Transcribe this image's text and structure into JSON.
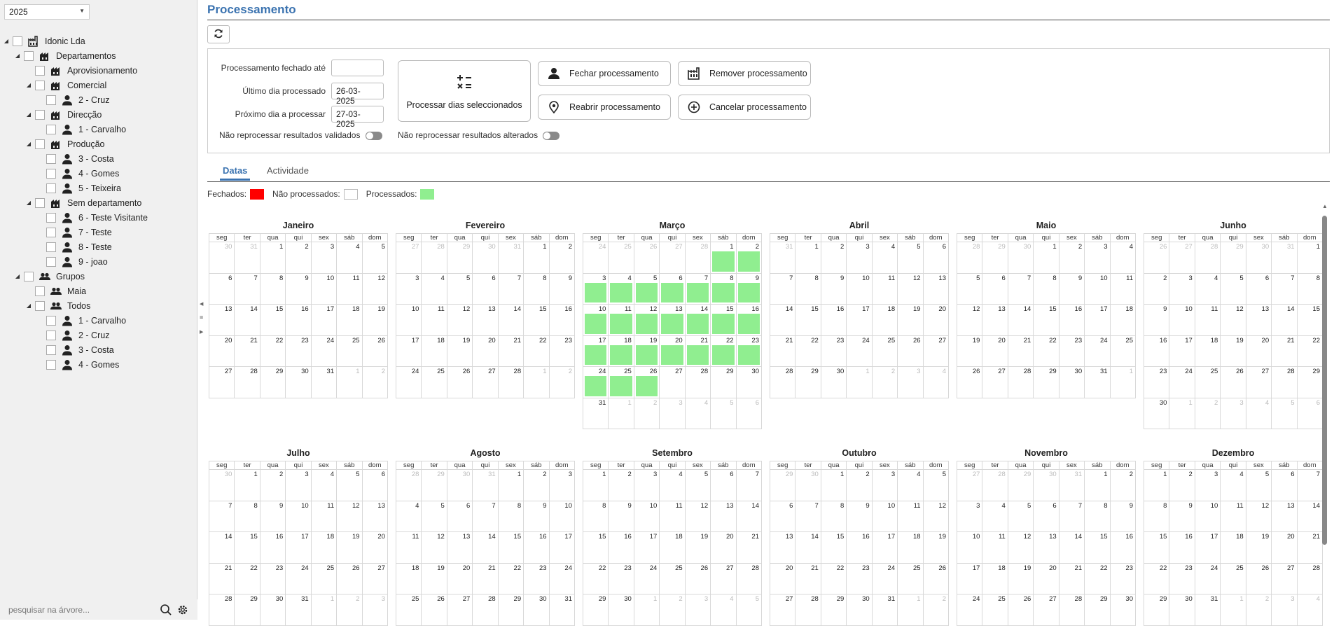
{
  "sidebar": {
    "year": "2025",
    "search_placeholder": "pesquisar na árvore...",
    "tree": [
      {
        "label": "Idonic Lda",
        "level": 0,
        "icon": "company-icon",
        "expanded": true
      },
      {
        "label": "Departamentos",
        "level": 1,
        "icon": "factory-icon",
        "expanded": true
      },
      {
        "label": "Aprovisionamento",
        "level": 2,
        "icon": "factory-icon",
        "expanded": false,
        "leaf": true
      },
      {
        "label": "Comercial",
        "level": 2,
        "icon": "factory-icon",
        "expanded": true
      },
      {
        "label": "2 - Cruz",
        "level": 3,
        "icon": "person-icon",
        "leaf": true
      },
      {
        "label": "Direcção",
        "level": 2,
        "icon": "factory-icon",
        "expanded": true
      },
      {
        "label": "1 - Carvalho",
        "level": 3,
        "icon": "person-icon",
        "leaf": true
      },
      {
        "label": "Produção",
        "level": 2,
        "icon": "factory-icon",
        "expanded": true
      },
      {
        "label": "3 - Costa",
        "level": 3,
        "icon": "person-icon",
        "leaf": true
      },
      {
        "label": "4 - Gomes",
        "level": 3,
        "icon": "person-icon",
        "leaf": true
      },
      {
        "label": "5 - Teixeira",
        "level": 3,
        "icon": "person-icon",
        "leaf": true
      },
      {
        "label": "Sem departamento",
        "level": 2,
        "icon": "factory-icon",
        "expanded": true
      },
      {
        "label": "6 - Teste Visitante",
        "level": 3,
        "icon": "person-icon",
        "leaf": true
      },
      {
        "label": "7 - Teste",
        "level": 3,
        "icon": "person-icon",
        "leaf": true
      },
      {
        "label": "8 - Teste",
        "level": 3,
        "icon": "person-icon",
        "leaf": true
      },
      {
        "label": "9 - joao",
        "level": 3,
        "icon": "person-icon",
        "leaf": true
      },
      {
        "label": "Grupos",
        "level": 1,
        "icon": "group-icon",
        "expanded": true
      },
      {
        "label": "Maia",
        "level": 2,
        "icon": "group-icon",
        "leaf": true
      },
      {
        "label": "Todos",
        "level": 2,
        "icon": "group-icon",
        "expanded": true
      },
      {
        "label": "1 - Carvalho",
        "level": 3,
        "icon": "person-icon",
        "leaf": true
      },
      {
        "label": "2 - Cruz",
        "level": 3,
        "icon": "person-icon",
        "leaf": true
      },
      {
        "label": "3 - Costa",
        "level": 3,
        "icon": "person-icon",
        "leaf": true
      },
      {
        "label": "4 - Gomes",
        "level": 3,
        "icon": "person-icon",
        "leaf": true
      }
    ]
  },
  "page": {
    "title": "Processamento"
  },
  "form": {
    "closed_until_label": "Processamento fechado até",
    "closed_until_value": "",
    "last_day_label": "Último dia processado",
    "last_day_value": "26-03-2025",
    "next_day_label": "Próximo dia a processar",
    "next_day_value": "27-03-2025",
    "no_reprocess_validated_label": "Não reprocessar resultados validados",
    "no_reprocess_changed_label": "Não reprocessar resultados alterados"
  },
  "buttons": {
    "process_selected": "Processar dias seleccionados",
    "close": "Fechar processamento",
    "remove": "Remover processamento",
    "reopen": "Reabrir processamento",
    "cancel": "Cancelar processamento"
  },
  "tabs": [
    {
      "label": "Datas",
      "active": true
    },
    {
      "label": "Actividade",
      "active": false
    }
  ],
  "legend": {
    "closed": "Fechados:",
    "closed_color": "#ff0000",
    "unprocessed": "Não processados:",
    "unprocessed_color": "#ffffff",
    "processed": "Processados:",
    "processed_color": "#90ee90"
  },
  "calendar": {
    "year": 2025,
    "weekdays": [
      "seg",
      "ter",
      "qua",
      "qui",
      "sex",
      "sáb",
      "dom"
    ],
    "months": [
      "Janeiro",
      "Fevereiro",
      "Março",
      "Abril",
      "Maio",
      "Junho",
      "Julho",
      "Agosto",
      "Setembro",
      "Outubro",
      "Novembro",
      "Dezembro"
    ],
    "processed": {
      "month": 3,
      "from": 1,
      "to": 26
    }
  }
}
